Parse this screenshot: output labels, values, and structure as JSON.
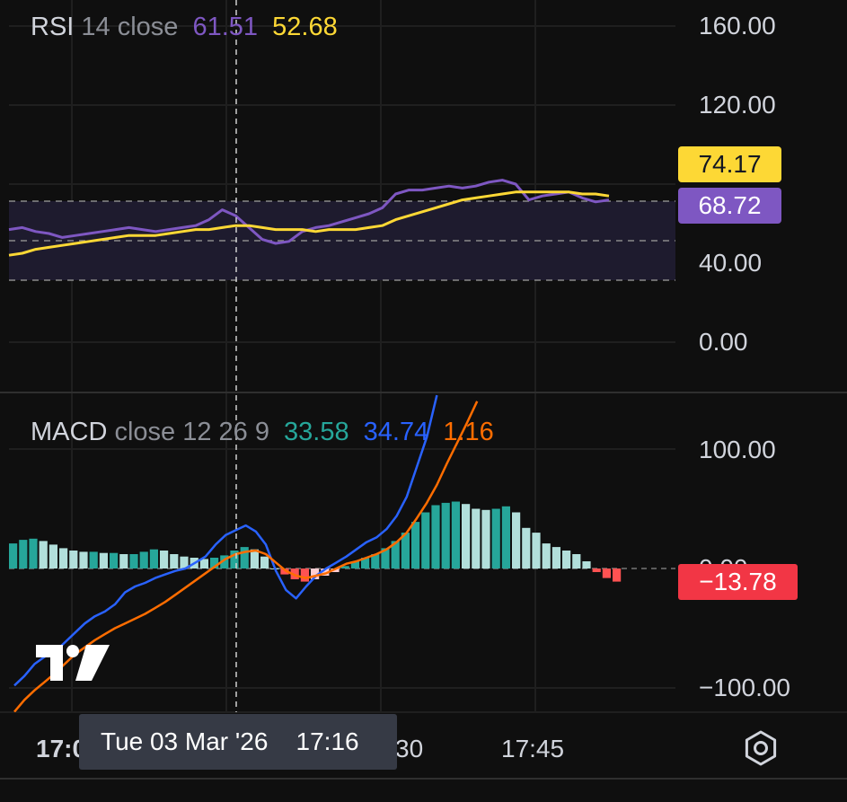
{
  "rsi": {
    "name": "RSI",
    "params": "14 close",
    "value_rsi": "61.51",
    "value_ma": "52.68",
    "colors": {
      "rsi": "#7e57c2",
      "ma": "#fdd835",
      "band": "#1e1b2e"
    },
    "axis": [
      "160.00",
      "120.00",
      "40.00",
      "0.00"
    ],
    "badges": [
      {
        "label": "74.17",
        "bg": "#fdd835",
        "fg": "#131722"
      },
      {
        "label": "68.72",
        "bg": "#7e57c2",
        "fg": "#ffffff"
      }
    ]
  },
  "macd": {
    "name": "MACD",
    "params": "close 12 26 9",
    "value_hist": "33.58",
    "value_macd": "34.74",
    "value_signal": "1.16",
    "colors": {
      "hist": "#26a69a",
      "macd": "#2962ff",
      "signal": "#ff6d00",
      "neg": "#ef5350"
    },
    "axis": [
      "100.00",
      "0.00",
      "−100.00"
    ],
    "badge": {
      "label": "−13.78",
      "bg": "#f23645",
      "fg": "#ffffff"
    }
  },
  "time_axis": {
    "labels": [
      "17:0",
      "30",
      "17:45"
    ]
  },
  "crosshair": {
    "tooltip": "Tue 03 Mar '26    17:16"
  },
  "icons": {
    "settings": "settings-gear-icon",
    "logo": "tradingview-logo-icon"
  },
  "chart_data": [
    {
      "type": "line",
      "title": "RSI 14 close",
      "ylim": [
        0,
        160
      ],
      "series": [
        {
          "name": "RSI",
          "values": [
            57,
            58,
            56,
            55,
            53,
            54,
            55,
            56,
            57,
            58,
            57,
            56,
            57,
            58,
            59,
            62,
            67,
            64,
            58,
            52,
            50,
            51,
            56,
            58,
            59,
            61,
            63,
            65,
            68,
            75,
            77,
            77,
            78,
            79,
            78,
            79,
            81,
            82,
            80,
            72,
            74,
            75,
            76,
            73,
            71,
            72
          ]
        },
        {
          "name": "RSI MA",
          "values": [
            44,
            45,
            47,
            48,
            49,
            50,
            51,
            52,
            53,
            54,
            54,
            54,
            55,
            56,
            57,
            57,
            58,
            59,
            59,
            58,
            57,
            57,
            57,
            56,
            57,
            57,
            57,
            58,
            59,
            62,
            64,
            66,
            68,
            70,
            72,
            73,
            74,
            75,
            76,
            76,
            76,
            76,
            76,
            75,
            75,
            74
          ]
        }
      ]
    },
    {
      "type": "bar",
      "title": "MACD close 12 26 9",
      "ylim": [
        -120,
        140
      ],
      "series": [
        {
          "name": "Histogram",
          "values": [
            21,
            24,
            25,
            23,
            20,
            17,
            15,
            14,
            14,
            13,
            13,
            12,
            12,
            14,
            16,
            15,
            12,
            10,
            9,
            8,
            9,
            11,
            15,
            18,
            16,
            10,
            0,
            -5,
            -9,
            -11,
            -9,
            -6,
            -3,
            2,
            6,
            9,
            12,
            17,
            23,
            30,
            39,
            47,
            53,
            55,
            56,
            54,
            50,
            49,
            50,
            52,
            47,
            34,
            30,
            21,
            18,
            15,
            12,
            6,
            -3,
            -8,
            -11
          ]
        },
        {
          "name": "MACD",
          "values": [
            -98,
            -90,
            -80,
            -74,
            -70,
            -62,
            -54,
            -46,
            -40,
            -36,
            -30,
            -20,
            -15,
            -12,
            -8,
            -5,
            -2,
            0,
            5,
            10,
            20,
            28,
            32,
            36,
            31,
            20,
            -2,
            -18,
            -25,
            -15,
            -6,
            0,
            5,
            10,
            16,
            22,
            26,
            33,
            44,
            60,
            85,
            110,
            145
          ]
        },
        {
          "name": "Signal",
          "values": [
            -120,
            -110,
            -102,
            -95,
            -88,
            -80,
            -72,
            -66,
            -60,
            -55,
            -50,
            -46,
            -42,
            -38,
            -33,
            -28,
            -22,
            -16,
            -10,
            -4,
            2,
            8,
            12,
            14,
            15,
            12,
            5,
            -2,
            -6,
            -8,
            -6,
            -4,
            0,
            4,
            6,
            9,
            12,
            16,
            22,
            30,
            42,
            55,
            70,
            88,
            105,
            122,
            140
          ]
        }
      ]
    }
  ]
}
